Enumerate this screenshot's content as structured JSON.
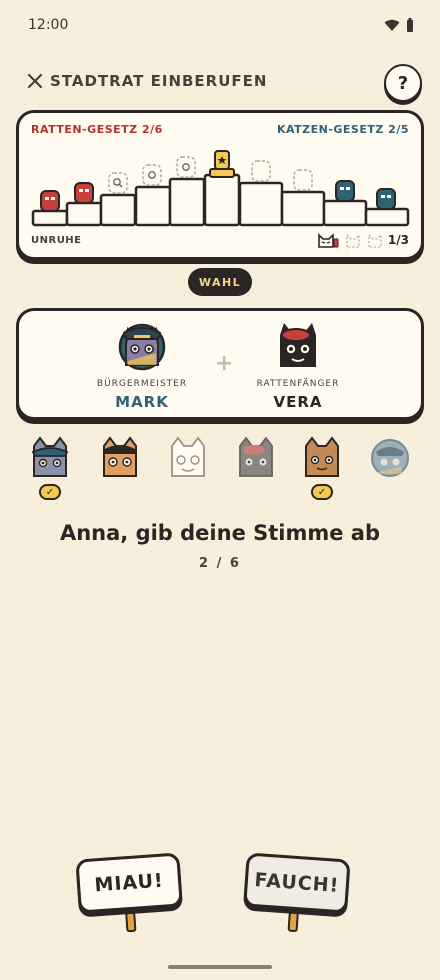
{
  "status_bar": {
    "time": "12:00"
  },
  "header": {
    "title": "STADTRAT EINBERUFEN",
    "help_label": "?"
  },
  "track": {
    "rat_law": "RATTEN-GESETZ 2/6",
    "cat_law": "KATZEN-GESETZ 2/5",
    "unrest_label": "UNRUHE",
    "unrest_count": "1/3"
  },
  "phase": "WAHL",
  "government": {
    "president": {
      "role": "BÜRGERMEISTER",
      "name": "MARK"
    },
    "chancellor": {
      "role": "RATTENFÄNGER",
      "name": "VERA"
    }
  },
  "voters": [
    {
      "icon": "cat-blue-cap-icon",
      "voted": true
    },
    {
      "icon": "cat-orange-cap-icon",
      "voted": false
    },
    {
      "icon": "cat-white-outline-icon",
      "voted": false
    },
    {
      "icon": "cat-gray-beret-icon",
      "voted": false
    },
    {
      "icon": "cat-brown-icon",
      "voted": true
    },
    {
      "icon": "cat-navy-hat-icon",
      "voted": false
    }
  ],
  "prompt": "Anna, gib deine Stimme ab",
  "vote_progress": "2 / 6",
  "buttons": {
    "yes": "MIAU!",
    "no": "FAUCH!"
  },
  "colors": {
    "rat": "#b4322d",
    "cat": "#2e6275",
    "accent": "#f4c94f",
    "ink": "#2b2523"
  }
}
